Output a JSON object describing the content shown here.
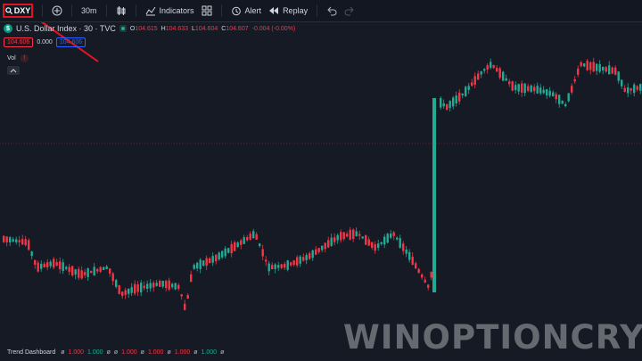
{
  "toolbar": {
    "symbol": "DXY",
    "interval": "30m",
    "indicators_label": "Indicators",
    "alert_label": "Alert",
    "replay_label": "Replay"
  },
  "legend": {
    "symbol_initial": "$",
    "title": "U.S. Dollar Index · 30 · TVC",
    "open_label": "O",
    "open": "104.615",
    "high_label": "H",
    "high": "104.633",
    "low_label": "L",
    "low": "104.604",
    "close_label": "C",
    "close": "104.607",
    "change": "-0.004 (-0.00%)"
  },
  "price_row": {
    "bid": "104.606",
    "spread": "0.000",
    "ask": "104.606"
  },
  "volume": {
    "label": "Vol",
    "warning": "!"
  },
  "bottom": {
    "name": "Trend Dashboard",
    "cells": [
      {
        "z": "ø",
        "v": "1.000",
        "c": "red"
      },
      {
        "z": "",
        "v": "1.000",
        "c": "green"
      },
      {
        "z": "ø",
        "v": "",
        "c": ""
      },
      {
        "z": "ø",
        "v": "1.000",
        "c": "red"
      },
      {
        "z": "ø",
        "v": "1.000",
        "c": "red"
      },
      {
        "z": "ø",
        "v": "1.000",
        "c": "red"
      },
      {
        "z": "ø",
        "v": "1.000",
        "c": "green"
      },
      {
        "z": "ø",
        "v": "",
        "c": ""
      }
    ]
  },
  "watermark": "WINOPTIONCRYPTO.COM",
  "colors": {
    "up": "#22ab94",
    "down": "#f23645",
    "highlight": "#e0141e",
    "background": "#161a25"
  }
}
